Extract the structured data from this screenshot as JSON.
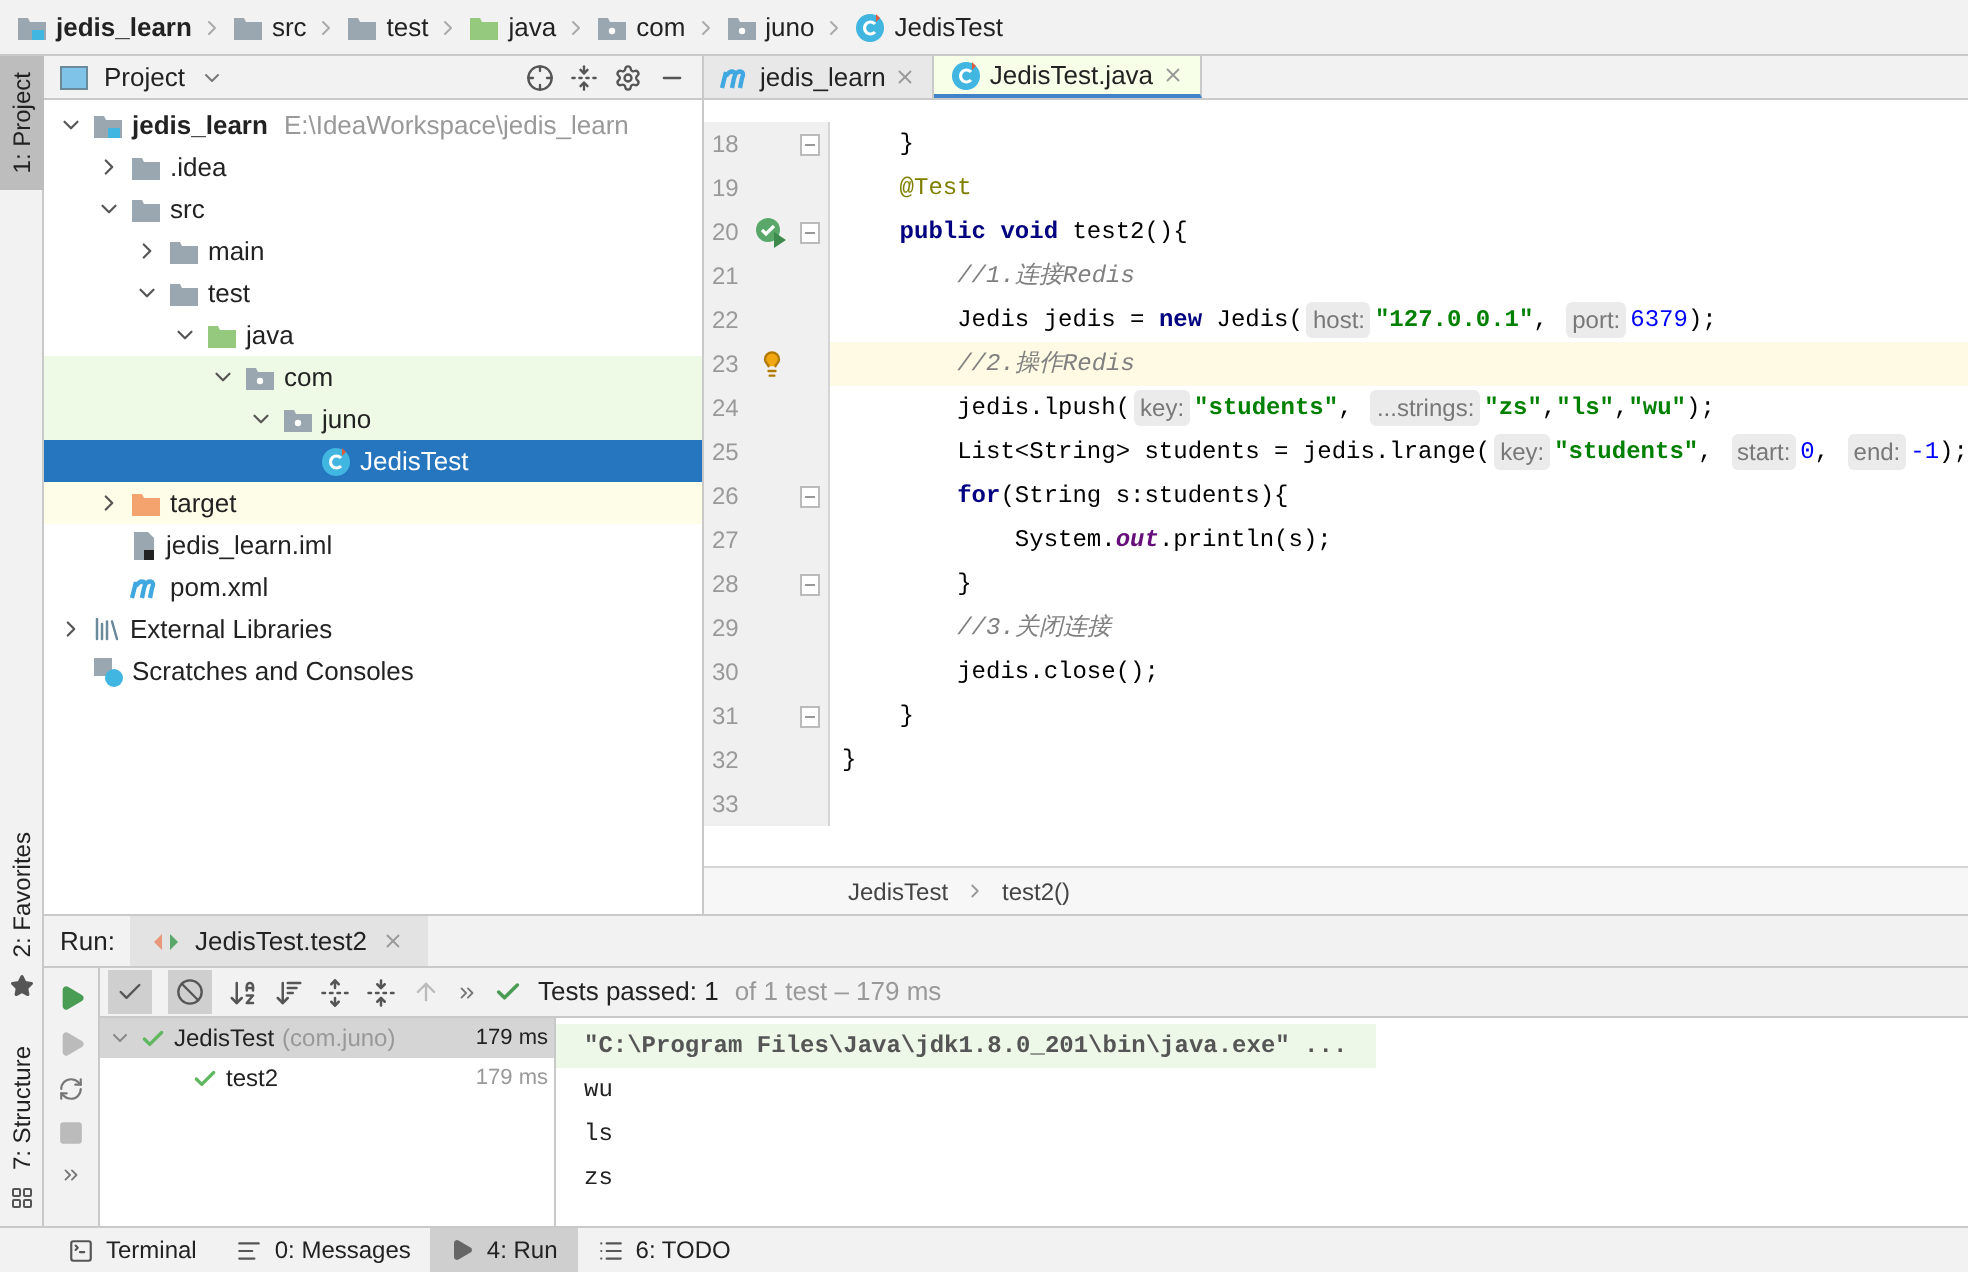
{
  "breadcrumb": [
    {
      "kind": "module",
      "label": "jedis_learn"
    },
    {
      "kind": "folder",
      "label": "src"
    },
    {
      "kind": "folder",
      "label": "test"
    },
    {
      "kind": "source",
      "label": "java"
    },
    {
      "kind": "package",
      "label": "com"
    },
    {
      "kind": "package",
      "label": "juno"
    },
    {
      "kind": "class",
      "label": "JedisTest"
    }
  ],
  "side_tabs": [
    {
      "label": "1: Project",
      "selected": true
    },
    {
      "label": "2: Favorites",
      "selected": false
    },
    {
      "label": "7: Structure",
      "selected": false
    }
  ],
  "project": {
    "title": "Project",
    "tree": [
      {
        "kind": "module",
        "label": "jedis_learn",
        "path": "E:\\IdeaWorkspace\\jedis_learn",
        "expanded": true,
        "selected": false,
        "children": [
          {
            "kind": "folder",
            "label": ".idea",
            "expanded": false,
            "selected": false
          },
          {
            "kind": "folder",
            "label": "src",
            "expanded": true,
            "selected": false,
            "children": [
              {
                "kind": "folder",
                "label": "main",
                "expanded": false,
                "selected": false
              },
              {
                "kind": "folder",
                "label": "test",
                "expanded": true,
                "selected": false,
                "children": [
                  {
                    "kind": "source",
                    "label": "java",
                    "expanded": true,
                    "selected": false,
                    "children": [
                      {
                        "kind": "package",
                        "label": "com",
                        "expanded": true,
                        "selected": false,
                        "children": [
                          {
                            "kind": "package",
                            "label": "juno",
                            "expanded": true,
                            "selected": false,
                            "children": [
                              {
                                "kind": "class",
                                "label": "JedisTest",
                                "selected": true
                              }
                            ]
                          }
                        ]
                      }
                    ]
                  }
                ]
              }
            ]
          },
          {
            "kind": "excluded",
            "label": "target",
            "expanded": false,
            "selected": false
          },
          {
            "kind": "iml",
            "label": "jedis_learn.iml",
            "selected": false
          },
          {
            "kind": "maven",
            "label": "pom.xml",
            "selected": false
          }
        ]
      },
      {
        "kind": "libraries",
        "label": "External Libraries",
        "expanded": false,
        "selected": false
      },
      {
        "kind": "scratches",
        "label": "Scratches and Consoles",
        "selected": false
      }
    ]
  },
  "editor": {
    "tabs": [
      {
        "kind": "maven",
        "label": "jedis_learn",
        "selected": false
      },
      {
        "kind": "class",
        "label": "JedisTest.java",
        "selected": true
      }
    ],
    "lines": [
      {
        "number": "18",
        "kind": "code",
        "fold": true,
        "current": false,
        "tokens": [
          {
            "kind": "plain",
            "text": "    }"
          }
        ]
      },
      {
        "number": "19",
        "kind": "code",
        "fold": false,
        "current": false,
        "tokens": [
          {
            "kind": "annotation",
            "text": "    @Test"
          }
        ]
      },
      {
        "number": "20",
        "kind": "test-method",
        "fold": true,
        "current": false,
        "tokens": [
          {
            "kind": "keyword",
            "text": "    public void "
          },
          {
            "kind": "plain",
            "text": "test2(){"
          }
        ]
      },
      {
        "number": "21",
        "kind": "code",
        "fold": false,
        "current": false,
        "tokens": [
          {
            "kind": "comment",
            "text": "        //1.连接Redis"
          }
        ]
      },
      {
        "number": "22",
        "kind": "code",
        "fold": false,
        "current": false,
        "tokens": [
          {
            "kind": "plain",
            "text": "        Jedis jedis = "
          },
          {
            "kind": "keyword",
            "text": "new "
          },
          {
            "kind": "plain",
            "text": "Jedis("
          },
          {
            "kind": "hint",
            "text": "host:"
          },
          {
            "kind": "string",
            "text": "\"127.0.0.1\""
          },
          {
            "kind": "plain",
            "text": ", "
          },
          {
            "kind": "hint",
            "text": "port:"
          },
          {
            "kind": "number",
            "text": "6379"
          },
          {
            "kind": "plain",
            "text": ");"
          }
        ]
      },
      {
        "number": "23",
        "kind": "intention",
        "fold": false,
        "current": true,
        "tokens": [
          {
            "kind": "comment",
            "text": "        //2.操作Redis"
          }
        ]
      },
      {
        "number": "24",
        "kind": "code",
        "fold": false,
        "current": false,
        "tokens": [
          {
            "kind": "plain",
            "text": "        jedis.lpush("
          },
          {
            "kind": "hint",
            "text": "key:"
          },
          {
            "kind": "string",
            "text": "\"students\""
          },
          {
            "kind": "plain",
            "text": ", "
          },
          {
            "kind": "hint",
            "text": "...strings:"
          },
          {
            "kind": "string",
            "text": "\"zs\""
          },
          {
            "kind": "plain",
            "text": ","
          },
          {
            "kind": "string",
            "text": "\"ls\""
          },
          {
            "kind": "plain",
            "text": ","
          },
          {
            "kind": "string",
            "text": "\"wu\""
          },
          {
            "kind": "plain",
            "text": ");"
          }
        ]
      },
      {
        "number": "25",
        "kind": "code",
        "fold": false,
        "current": false,
        "tokens": [
          {
            "kind": "plain",
            "text": "        List<String> students = jedis.lrange("
          },
          {
            "kind": "hint",
            "text": "key:"
          },
          {
            "kind": "string",
            "text": "\"students\""
          },
          {
            "kind": "plain",
            "text": ", "
          },
          {
            "kind": "hint",
            "text": "start:"
          },
          {
            "kind": "number",
            "text": "0"
          },
          {
            "kind": "plain",
            "text": ", "
          },
          {
            "kind": "hint",
            "text": "end:"
          },
          {
            "kind": "number",
            "text": "-1"
          },
          {
            "kind": "plain",
            "text": ");"
          }
        ]
      },
      {
        "number": "26",
        "kind": "code",
        "fold": true,
        "current": false,
        "tokens": [
          {
            "kind": "keyword",
            "text": "        for"
          },
          {
            "kind": "plain",
            "text": "(String s:students){"
          }
        ]
      },
      {
        "number": "27",
        "kind": "code",
        "fold": false,
        "current": false,
        "tokens": [
          {
            "kind": "plain",
            "text": "            System."
          },
          {
            "kind": "field",
            "text": "out"
          },
          {
            "kind": "plain",
            "text": ".println(s);"
          }
        ]
      },
      {
        "number": "28",
        "kind": "code",
        "fold": true,
        "current": false,
        "tokens": [
          {
            "kind": "plain",
            "text": "        }"
          }
        ]
      },
      {
        "number": "29",
        "kind": "code",
        "fold": false,
        "current": false,
        "tokens": [
          {
            "kind": "comment",
            "text": "        //3.关闭连接"
          }
        ]
      },
      {
        "number": "30",
        "kind": "code",
        "fold": false,
        "current": false,
        "tokens": [
          {
            "kind": "plain",
            "text": "        jedis.close();"
          }
        ]
      },
      {
        "number": "31",
        "kind": "code",
        "fold": true,
        "current": false,
        "tokens": [
          {
            "kind": "plain",
            "text": "    }"
          }
        ]
      },
      {
        "number": "32",
        "kind": "code",
        "fold": false,
        "current": false,
        "tokens": [
          {
            "kind": "plain",
            "text": "}"
          }
        ]
      },
      {
        "number": "33",
        "kind": "code",
        "fold": false,
        "current": false
      }
    ],
    "breadcrumb": [
      "JedisTest",
      "test2()"
    ]
  },
  "run": {
    "label": "Run:",
    "tab": "JedisTest.test2",
    "filters": [
      {
        "kind": "passed",
        "on": true
      },
      {
        "kind": "ignored",
        "on": true
      }
    ],
    "status": "Tests passed: 1",
    "status_detail": "of 1 test – 179 ms",
    "tests": [
      {
        "label": "JedisTest",
        "package": "(com.juno)",
        "time": "179 ms",
        "selected": true,
        "children": [
          {
            "label": "test2",
            "time": "179 ms",
            "selected": false
          }
        ]
      }
    ],
    "console": [
      {
        "kind": "command",
        "text": "\"C:\\Program Files\\Java\\jdk1.8.0_201\\bin\\java.exe\" ..."
      },
      {
        "kind": "output",
        "text": "wu"
      },
      {
        "kind": "output",
        "text": "ls"
      },
      {
        "kind": "output",
        "text": "zs"
      }
    ]
  },
  "bottom_tabs": [
    {
      "kind": "terminal",
      "label": "Terminal",
      "selected": false
    },
    {
      "kind": "messages",
      "label": "0: Messages",
      "selected": false
    },
    {
      "kind": "run",
      "label": "4: Run",
      "selected": true
    },
    {
      "kind": "todo",
      "label": "6: TODO",
      "selected": false
    }
  ]
}
